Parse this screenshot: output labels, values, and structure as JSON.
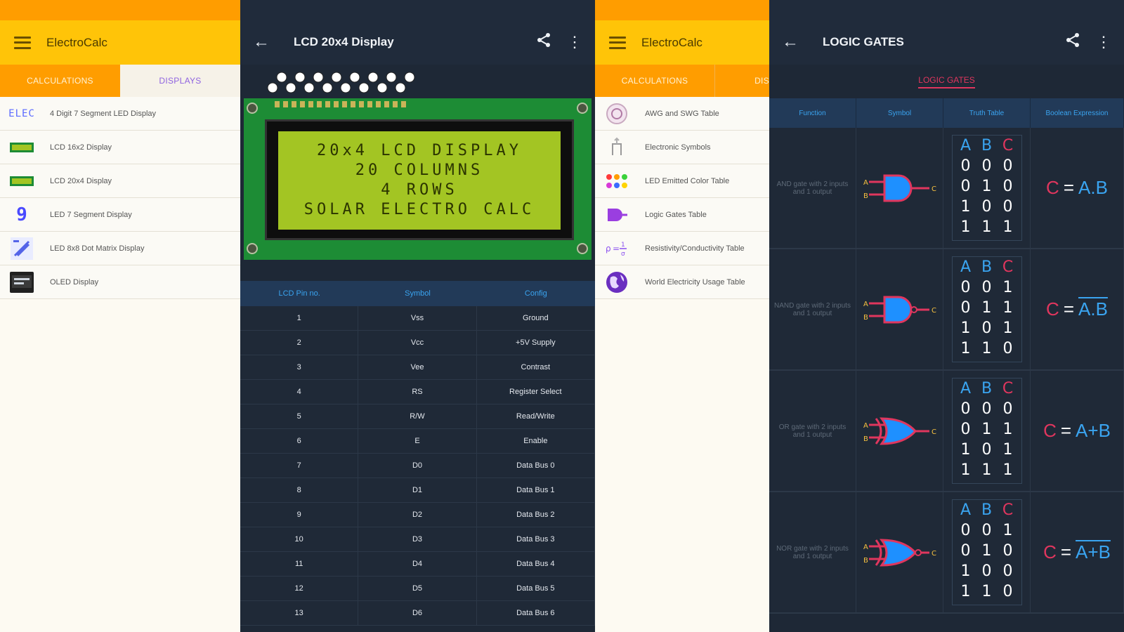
{
  "panel1": {
    "app_title": "ElectroCalc",
    "tabs": [
      "CALCULATIONS",
      "DISPLAYS"
    ],
    "items": [
      {
        "icon": "seven-segment-icon",
        "label": "4 Digit 7 Segment LED Display",
        "icon_text": "ELEC"
      },
      {
        "icon": "lcd-16x2-icon",
        "label": "LCD 16x2 Display"
      },
      {
        "icon": "lcd-20x4-icon",
        "label": "LCD 20x4 Display"
      },
      {
        "icon": "seven-segment-digit-icon",
        "label": "LED 7 Segment Display",
        "icon_text": "9"
      },
      {
        "icon": "dot-matrix-icon",
        "label": "LED 8x8 Dot Matrix Display"
      },
      {
        "icon": "oled-icon",
        "label": "OLED Display"
      }
    ]
  },
  "panel2": {
    "title": "LCD 20x4 Display",
    "lcd_lines": [
      "20x4 LCD DISPLAY",
      "20 COLUMNS",
      "4 ROWS",
      "SOLAR ELECTRO CALC"
    ],
    "table_headers": [
      "LCD Pin no.",
      "Symbol",
      "Config"
    ],
    "rows": [
      [
        "1",
        "Vss",
        "Ground"
      ],
      [
        "2",
        "Vcc",
        "+5V Supply"
      ],
      [
        "3",
        "Vee",
        "Contrast"
      ],
      [
        "4",
        "RS",
        "Register Select"
      ],
      [
        "5",
        "R/W",
        "Read/Write"
      ],
      [
        "6",
        "E",
        "Enable"
      ],
      [
        "7",
        "D0",
        "Data Bus 0"
      ],
      [
        "8",
        "D1",
        "Data Bus 1"
      ],
      [
        "9",
        "D2",
        "Data Bus 2"
      ],
      [
        "10",
        "D3",
        "Data Bus 3"
      ],
      [
        "11",
        "D4",
        "Data Bus 4"
      ],
      [
        "12",
        "D5",
        "Data Bus 5"
      ],
      [
        "13",
        "D6",
        "Data Bus 6"
      ]
    ]
  },
  "panel3": {
    "app_title": "ElectroCalc",
    "tabs": [
      "CALCULATIONS",
      "DIS"
    ],
    "items": [
      {
        "icon": "awg-icon",
        "label": "AWG and SWG Table"
      },
      {
        "icon": "symbol-icon",
        "label": "Electronic Symbols"
      },
      {
        "icon": "led-colors-icon",
        "label": "LED Emitted Color Table"
      },
      {
        "icon": "logic-gate-icon",
        "label": "Logic Gates Table"
      },
      {
        "icon": "resistivity-icon",
        "label": "Resistivity/Conductivity Table"
      },
      {
        "icon": "globe-icon",
        "label": "World Electricity Usage Table"
      }
    ]
  },
  "panel4": {
    "title": "LOGIC GATES",
    "tab": "LOGIC GATES",
    "headers": [
      "Function",
      "Symbol",
      "Truth Table",
      "Boolean Expression"
    ],
    "gates": [
      {
        "function": "AND gate with 2 inputs and 1 output",
        "type": "and",
        "truth": [
          [
            "0",
            "0",
            "0"
          ],
          [
            "0",
            "1",
            "0"
          ],
          [
            "1",
            "0",
            "0"
          ],
          [
            "1",
            "1",
            "1"
          ]
        ],
        "expr": "A.B",
        "negated": false
      },
      {
        "function": "NAND gate with 2 inputs and 1 output",
        "type": "nand",
        "truth": [
          [
            "0",
            "0",
            "1"
          ],
          [
            "0",
            "1",
            "1"
          ],
          [
            "1",
            "0",
            "1"
          ],
          [
            "1",
            "1",
            "0"
          ]
        ],
        "expr": "A.B",
        "negated": true
      },
      {
        "function": "OR gate with 2 inputs and 1 output",
        "type": "or",
        "truth": [
          [
            "0",
            "0",
            "0"
          ],
          [
            "0",
            "1",
            "1"
          ],
          [
            "1",
            "0",
            "1"
          ],
          [
            "1",
            "1",
            "1"
          ]
        ],
        "expr": "A+B",
        "negated": false
      },
      {
        "function": "NOR gate with 2 inputs and 1 output",
        "type": "nor",
        "truth": [
          [
            "0",
            "0",
            "1"
          ],
          [
            "0",
            "1",
            "0"
          ],
          [
            "1",
            "0",
            "0"
          ],
          [
            "1",
            "1",
            "0"
          ]
        ],
        "expr": "A+B",
        "negated": true
      }
    ],
    "truth_headers": [
      "A",
      "B",
      "C"
    ],
    "expr_lhs": "C",
    "expr_eq": "="
  },
  "colors": {
    "orange": "#ff9d00",
    "yellow": "#ffc408",
    "dark_bg": "#1e2836",
    "blue_accent": "#3aa4f0",
    "red_accent": "#e0365e",
    "lcd_green": "#a3c523",
    "pcb_green": "#1d8c35"
  }
}
